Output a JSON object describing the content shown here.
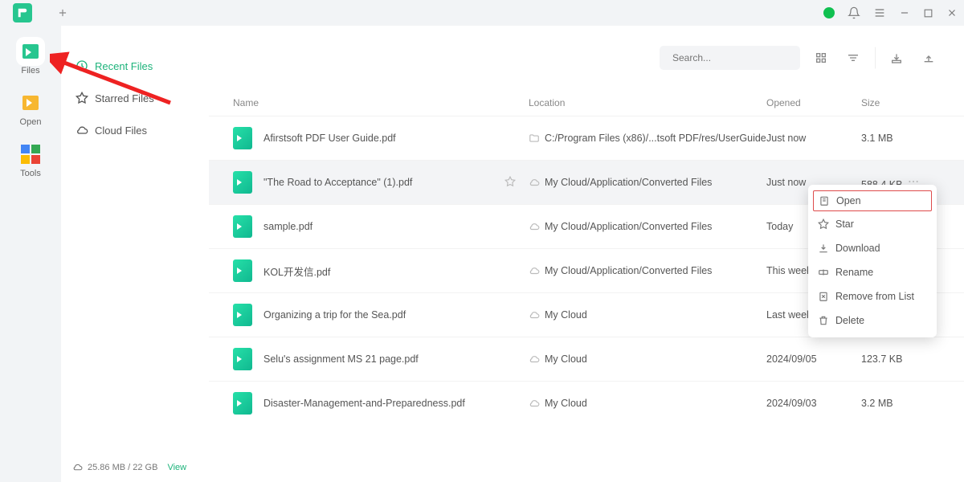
{
  "navrail": {
    "items": [
      {
        "label": "Files"
      },
      {
        "label": "Open"
      },
      {
        "label": "Tools"
      }
    ]
  },
  "sidebar": {
    "items": [
      {
        "label": "Recent Files"
      },
      {
        "label": "Starred Files"
      },
      {
        "label": "Cloud Files"
      }
    ],
    "storage": "25.86 MB / 22 GB",
    "view_link": "View"
  },
  "search": {
    "placeholder": "Search..."
  },
  "table": {
    "headers": {
      "name": "Name",
      "location": "Location",
      "opened": "Opened",
      "size": "Size"
    },
    "rows": [
      {
        "name": "Afirstsoft PDF User Guide.pdf",
        "loc_icon": "folder",
        "location": "C:/Program Files (x86)/...tsoft PDF/res/UserGuide",
        "opened": "Just now",
        "size": "3.1 MB"
      },
      {
        "name": "\"The Road to Acceptance\" (1).pdf",
        "loc_icon": "cloud",
        "location": "My Cloud/Application/Converted Files",
        "opened": "Just now",
        "size": "588.4 KB",
        "hovered": true,
        "star": true
      },
      {
        "name": "sample.pdf",
        "loc_icon": "cloud",
        "location": "My Cloud/Application/Converted Files",
        "opened": "Today",
        "size": ""
      },
      {
        "name": "KOL开发信.pdf",
        "loc_icon": "cloud",
        "location": "My Cloud/Application/Converted Files",
        "opened": "This week",
        "size": ""
      },
      {
        "name": "Organizing a trip for the Sea.pdf",
        "loc_icon": "cloud",
        "location": "My Cloud",
        "opened": "Last week",
        "size": ""
      },
      {
        "name": "Selu's assignment MS 21 page.pdf",
        "loc_icon": "cloud",
        "location": "My Cloud",
        "opened": "2024/09/05",
        "size": "123.7 KB"
      },
      {
        "name": "Disaster-Management-and-Preparedness.pdf",
        "loc_icon": "cloud",
        "location": "My Cloud",
        "opened": "2024/09/03",
        "size": "3.2 MB"
      }
    ]
  },
  "context_menu": {
    "items": [
      {
        "label": "Open"
      },
      {
        "label": "Star"
      },
      {
        "label": "Download"
      },
      {
        "label": "Rename"
      },
      {
        "label": "Remove from List"
      },
      {
        "label": "Delete"
      }
    ]
  }
}
